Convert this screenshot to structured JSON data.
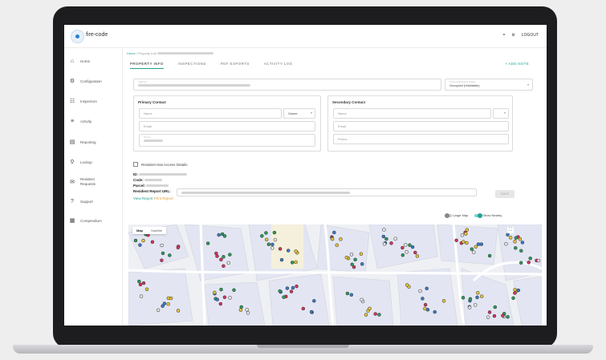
{
  "app": {
    "logo_text": "fire-code"
  },
  "topbar": {
    "logout_label": "LOGOUT",
    "icon_a": "dash",
    "icon_b": "gear-icon"
  },
  "sidebar": {
    "items": [
      {
        "label": "Home",
        "icon": "home-icon"
      },
      {
        "label": "Configuration",
        "icon": "gear-icon"
      },
      {
        "label": "Inspectors",
        "icon": "people-icon"
      },
      {
        "label": "Activity",
        "icon": "activity-icon"
      },
      {
        "label": "Reporting",
        "icon": "report-icon"
      },
      {
        "label": "Lookup",
        "icon": "search-icon"
      },
      {
        "label": "Resident Requests",
        "icon": "mail-icon"
      },
      {
        "label": "Support",
        "icon": "help-icon"
      },
      {
        "label": "Compendium",
        "icon": "book-icon"
      }
    ]
  },
  "breadcrumb": {
    "home": "Home",
    "sep": "/",
    "current": "Property Info"
  },
  "tabs": [
    "PROPERTY INFO",
    "INSPECTIONS",
    "PDF EXPORTS",
    "ACTIVITY LOG"
  ],
  "add_note": "+ ADD NOTE",
  "address": {
    "label": "Address"
  },
  "primary_business": {
    "label": "Primary Business Status",
    "value": "Occupied (Habitable)"
  },
  "primary_contact": {
    "title": "Primary Contact",
    "name_placeholder": "Name",
    "role": "Owner",
    "email_placeholder": "Email",
    "phone_label": "Phone"
  },
  "secondary_contact": {
    "title": "Secondary Contact",
    "name_placeholder": "Name",
    "email_placeholder": "Email",
    "phone_placeholder": "Phone"
  },
  "resident_access": "Resident Has Access Details",
  "info": {
    "id_label": "ID:",
    "code_label": "Code:",
    "parcel_label": "Parcel:",
    "report_url_label": "Resident Report URL:",
    "view_report": "View Report",
    "print_report": "Print Report",
    "save_label": "SAVE"
  },
  "map": {
    "tab_map": "Map",
    "tab_satellite": "Satellite",
    "large_map_label": "Large Map",
    "show_nearby_label": "Show Nearby",
    "large_map_on": false,
    "show_nearby_on": true
  },
  "colors": {
    "accent": "#21a393",
    "secondary_link": "#e59a3a",
    "marker_colors": [
      "#e4c23b",
      "#2b9a5a",
      "#d2345d",
      "#3a78c8",
      "#e7e7e7"
    ]
  }
}
